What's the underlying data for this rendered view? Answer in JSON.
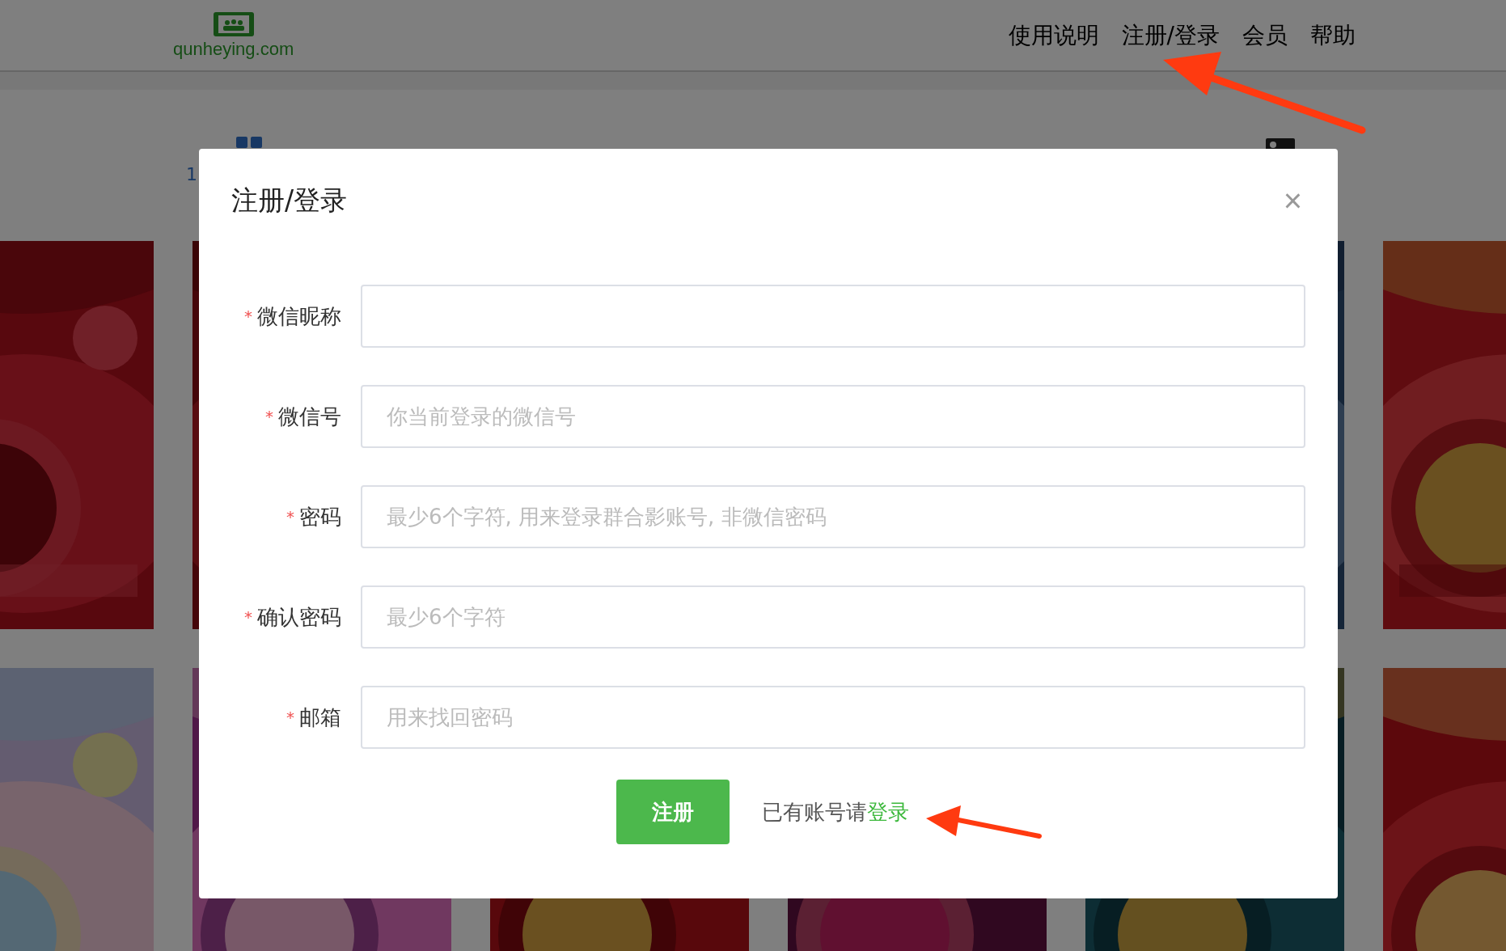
{
  "header": {
    "logo_text": "qunheying.com",
    "nav": [
      {
        "label": "使用说明"
      },
      {
        "label": "注册/登录"
      },
      {
        "label": "会员"
      },
      {
        "label": "帮助"
      }
    ]
  },
  "background_text": "1",
  "dialog": {
    "title": "注册/登录",
    "close": "×",
    "fields": [
      {
        "label": "微信昵称",
        "required_mark": "*"
      },
      {
        "label": "微信号",
        "required_mark": "*",
        "placeholder": "你当前登录的微信号"
      },
      {
        "label": "密码",
        "required_mark": "*",
        "placeholder": "最少6个字符, 用来登录群合影账号, 非微信密码"
      },
      {
        "label": "确认密码",
        "required_mark": "*",
        "placeholder": "最少6个字符"
      },
      {
        "label": "邮箱",
        "required_mark": "*",
        "placeholder": "用来找回密码"
      }
    ],
    "submit": "注册",
    "login_prompt": "已有账号请",
    "login_link": "登录"
  }
}
